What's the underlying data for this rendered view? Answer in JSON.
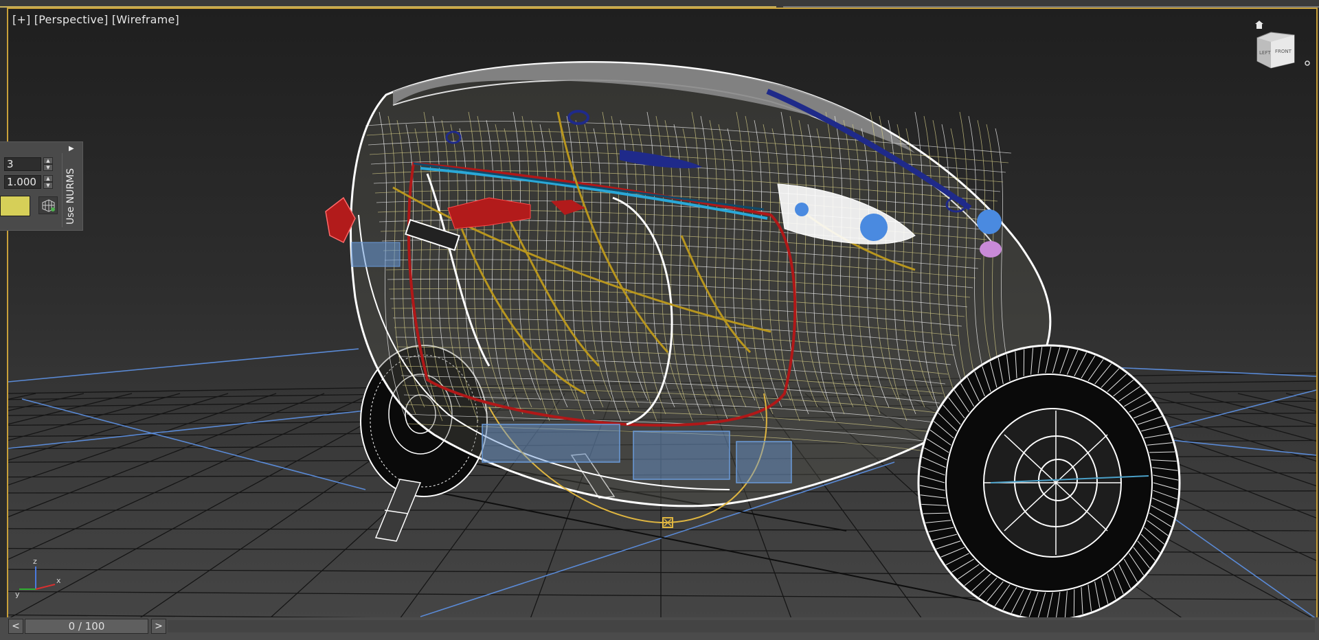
{
  "viewport": {
    "label_plus": "[+]",
    "label_view": "[Perspective]",
    "label_shading": "[Wireframe]"
  },
  "viewcube": {
    "left_face": "LEFT",
    "front_face": "FRONT"
  },
  "panel": {
    "iterations_value": "3",
    "smoothness_value": "1.000",
    "use_nurms_label": "Use NURMS"
  },
  "axis_tripod": {
    "x": "x",
    "y": "y",
    "z": "z"
  },
  "time_slider": {
    "frame_label": "0 / 100",
    "prev_label": "<",
    "next_label": ">"
  },
  "colors": {
    "active_viewport_border": "#c9a13a",
    "grid_line": "#151515",
    "home_grid_axis": "#5a8ad6",
    "wire_white": "#ffffff",
    "wire_yellow": "#d8d08a",
    "wire_gold": "#b8961e",
    "wire_red": "#b01818",
    "wire_blue": "#6a9ad8",
    "wire_dark_blue": "#1f2a8a",
    "swatch_yellow": "#d6cf58"
  }
}
